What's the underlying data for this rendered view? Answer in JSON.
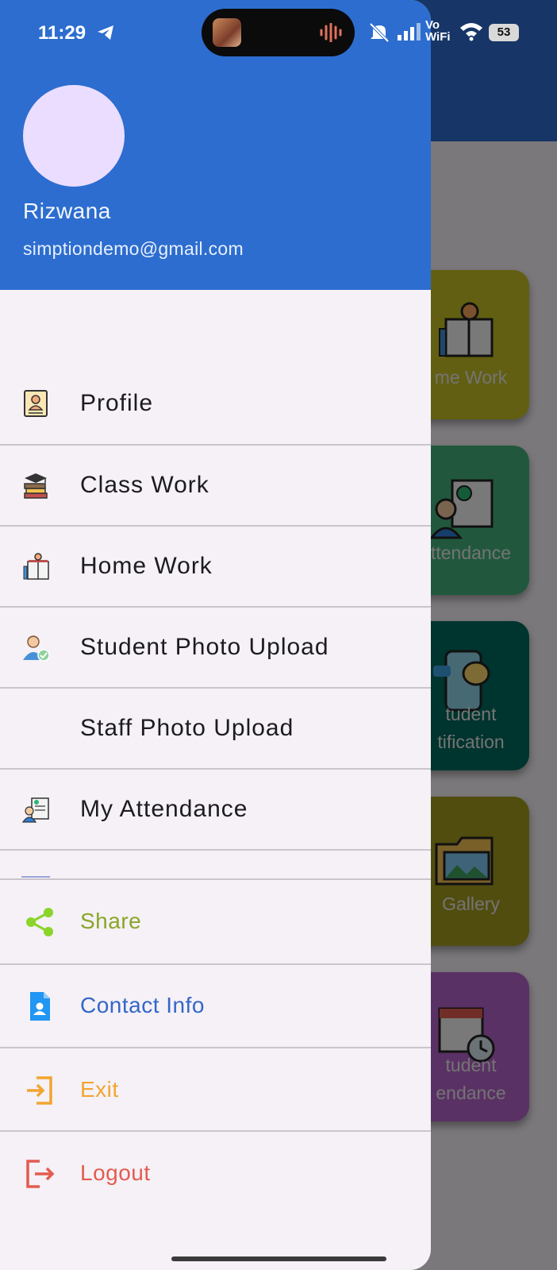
{
  "status_bar": {
    "time": "11:29",
    "battery": "53",
    "wifi_label": "Vo WiFi"
  },
  "drawer": {
    "user_name": "Rizwana",
    "user_email": "simptiondemo@gmail.com",
    "menu_items": [
      {
        "label": "Profile",
        "icon": "profile-card-icon"
      },
      {
        "label": "Class Work",
        "icon": "books-graduation-cap-icon"
      },
      {
        "label": "Home Work",
        "icon": "homework-book-icon"
      },
      {
        "label": "Student Photo Upload",
        "icon": "student-check-icon"
      },
      {
        "label": "Staff Photo Upload",
        "icon": ""
      },
      {
        "label": "My Attendance",
        "icon": "attendance-checklist-icon"
      }
    ],
    "actions": [
      {
        "label": "Share",
        "icon": "share-icon",
        "color": "#7cb32a"
      },
      {
        "label": "Contact Info",
        "icon": "contact-info-icon",
        "color": "#3466c9"
      },
      {
        "label": "Exit",
        "icon": "exit-icon",
        "color": "#f2a531"
      },
      {
        "label": "Logout",
        "icon": "logout-icon",
        "color": "#e35b4f"
      }
    ]
  },
  "background_cards": [
    {
      "label": "me Work",
      "color": "#c4bf25"
    },
    {
      "label": "ttendance",
      "color": "#42b07b"
    },
    {
      "label_line1": "tudent",
      "label_line2": "tification",
      "color": "#00685d"
    },
    {
      "label": "Gallery",
      "color": "#a39a1f"
    },
    {
      "label_line1": "tudent",
      "label_line2": "endance",
      "color": "#b462c9"
    }
  ]
}
